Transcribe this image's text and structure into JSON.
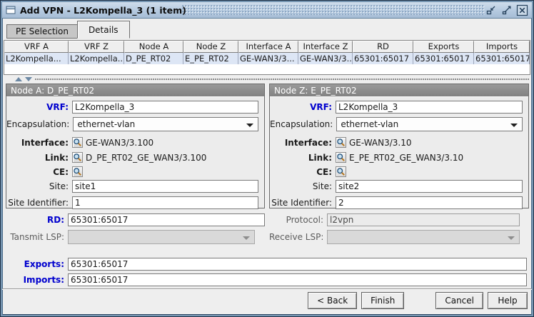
{
  "window": {
    "title": "Add VPN - L2Kompella_3 (1 item)"
  },
  "colors": {
    "frame_border": "#7796B2",
    "titlebar": "#B3C8DE",
    "accent_label": "#0000CE",
    "row_selection": "#DDE6F5",
    "panel_header": "#8B8B8B"
  },
  "tabs": {
    "pe_selection": "PE Selection",
    "details": "Details"
  },
  "table": {
    "columns": [
      "VRF A",
      "VRF Z",
      "Node A",
      "Node Z",
      "Interface A",
      "Interface Z",
      "RD",
      "Exports",
      "Imports"
    ],
    "row": [
      "L2Kompella...",
      "L2Kompella...",
      "D_PE_RT02",
      "E_PE_RT02",
      "GE-WAN3/3...",
      "GE-WAN3/3...",
      "65301:65017",
      "65301:65017",
      "65301:65017"
    ]
  },
  "panels": [
    {
      "title": "Node A: D_PE_RT02",
      "vrf_label": "VRF:",
      "vrf": "L2Kompella_3",
      "encap_label": "Encapsulation:",
      "encap": "ethernet-vlan",
      "interface_label": "Interface:",
      "interface": "GE-WAN3/3.100",
      "link_label": "Link:",
      "link": "D_PE_RT02_GE_WAN3/3.100",
      "ce_label": "CE:",
      "site_label": "Site:",
      "site": "site1",
      "site_id_label": "Site Identifier:",
      "site_id": "1"
    },
    {
      "title": "Node Z: E_PE_RT02",
      "vrf_label": "VRF:",
      "vrf": "L2Kompella_3",
      "encap_label": "Encapsulation:",
      "encap": "ethernet-vlan",
      "interface_label": "Interface:",
      "interface": "GE-WAN3/3.10",
      "link_label": "Link:",
      "link": "E_PE_RT02_GE_WAN3/3.10",
      "ce_label": "CE:",
      "site_label": "Site:",
      "site": "site2",
      "site_id_label": "Site Identifier:",
      "site_id": "2"
    }
  ],
  "form": {
    "rd_label": "RD:",
    "rd": "65301:65017",
    "protocol_label": "Protocol:",
    "protocol": "l2vpn",
    "transmit_label": "Tansmit LSP:",
    "receive_label": "Receive LSP:",
    "exports_label": "Exports:",
    "exports": "65301:65017",
    "imports_label": "Imports:",
    "imports": "65301:65017"
  },
  "buttons": {
    "back": "< Back",
    "finish": "Finish",
    "cancel": "Cancel",
    "help": "Help"
  }
}
